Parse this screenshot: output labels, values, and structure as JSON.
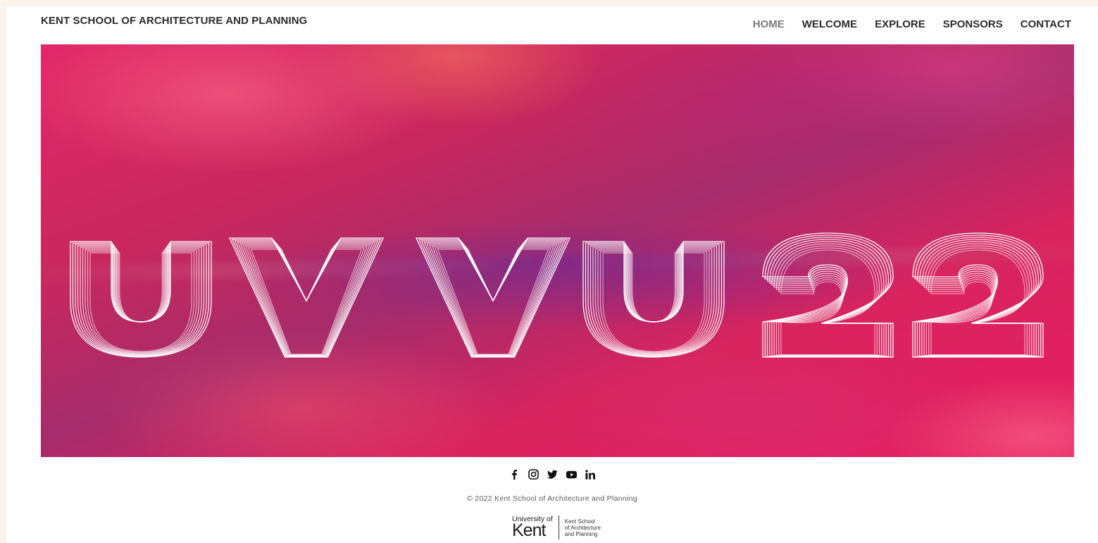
{
  "header": {
    "site_title": "KENT SCHOOL OF ARCHITECTURE AND PLANNING"
  },
  "nav": {
    "items": [
      {
        "label": "HOME",
        "active": true
      },
      {
        "label": "WELCOME",
        "active": false
      },
      {
        "label": "EXPLORE",
        "active": false
      },
      {
        "label": "SPONSORS",
        "active": false
      },
      {
        "label": "CONTACT",
        "active": false
      }
    ]
  },
  "hero": {
    "graphic_text": "UVVU22",
    "colors": {
      "primary": "#e31c63",
      "accent": "#7a2a9a",
      "outline": "#ffffff"
    }
  },
  "social": {
    "icons": [
      "facebook-icon",
      "instagram-icon",
      "twitter-icon",
      "youtube-icon",
      "linkedin-icon"
    ]
  },
  "footer": {
    "copyright": "© 2022 Kent School of Architecture and Planning",
    "logo": {
      "university_of": "University of",
      "kent": "Kent",
      "school_lines": [
        "Kent School",
        "of Architecture",
        "and Planning"
      ]
    }
  }
}
